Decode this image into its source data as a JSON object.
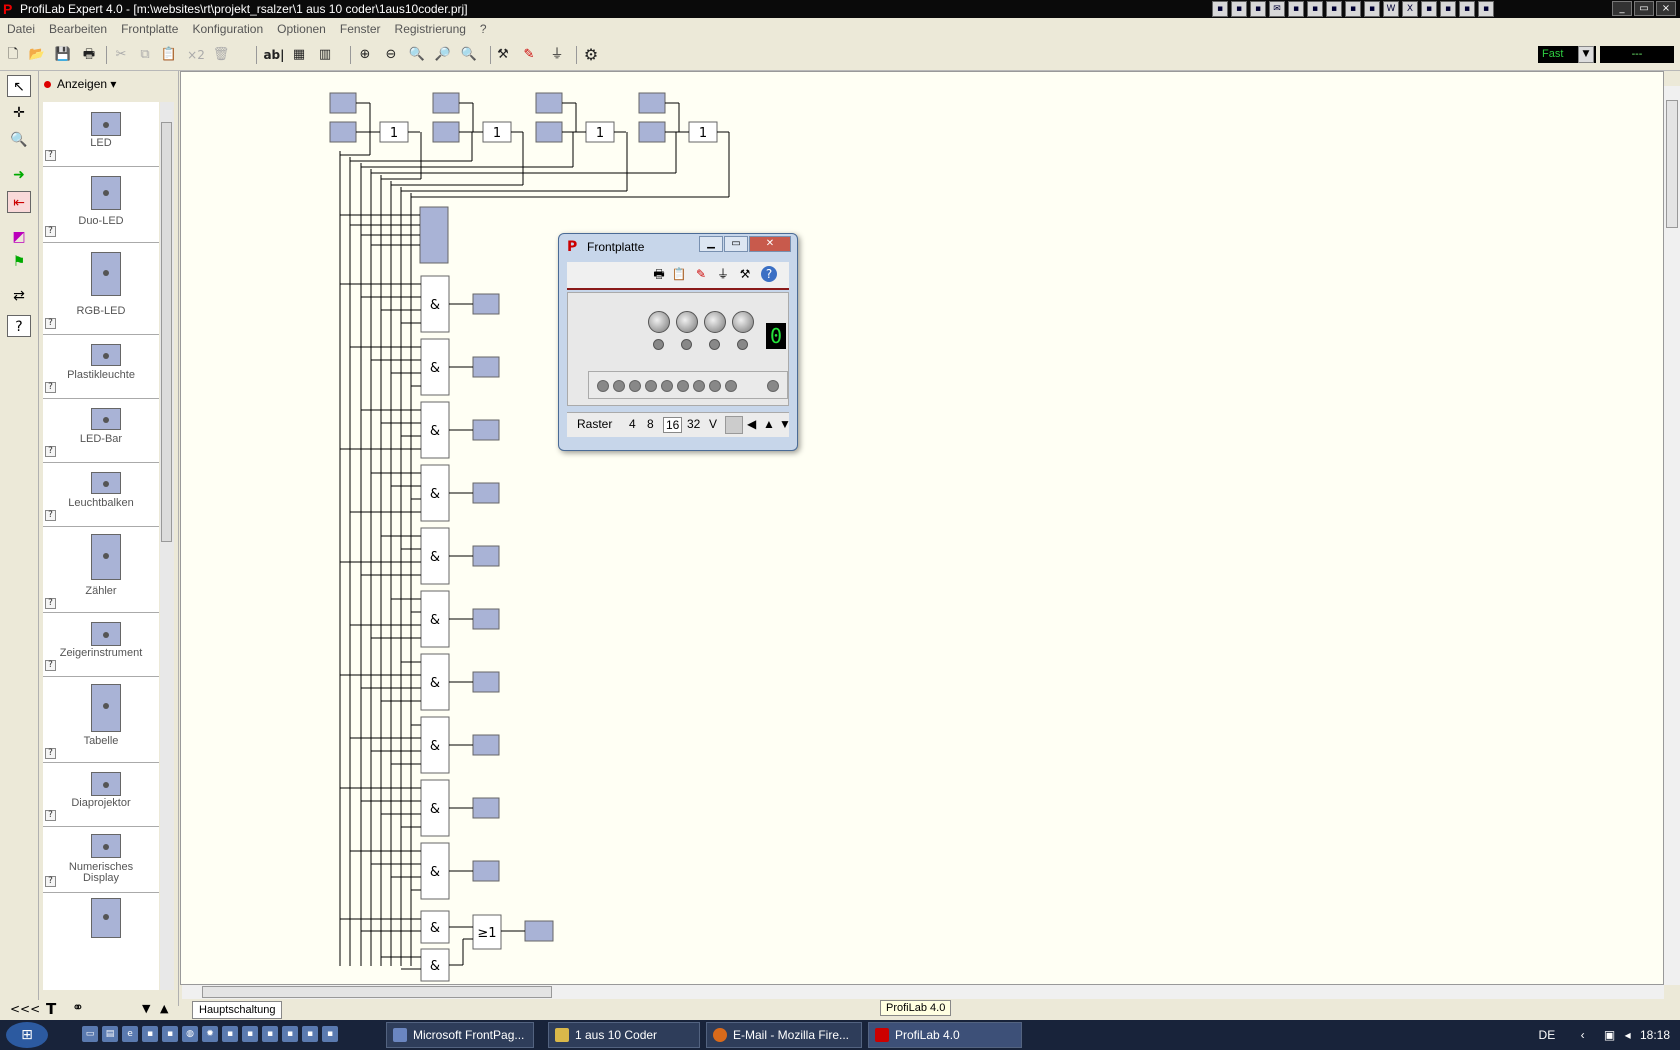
{
  "window": {
    "title": "ProfiLab Expert 4.0 - [m:\\websites\\rt\\projekt_rsalzer\\1 aus 10 coder\\1aus10coder.prj]",
    "app_letter": "P",
    "controls": [
      "_",
      "▭",
      "×"
    ]
  },
  "menu": [
    "Datei",
    "Bearbeiten",
    "Frontplatte",
    "Konfiguration",
    "Optionen",
    "Fenster",
    "Registrierung",
    "?"
  ],
  "toolbar": {
    "tools": [
      "new-file",
      "open-folder",
      "save",
      "print",
      "cut",
      "copy",
      "paste",
      "duplicate",
      "delete",
      "text-label",
      "grid",
      "columns",
      "zoom-in",
      "zoom-out",
      "zoom-fit",
      "zoom-window",
      "zoom-all",
      "tools",
      "wire",
      "plug",
      "settings"
    ],
    "text_ab": "ab|",
    "text_x2": "×2",
    "speed": "Fast",
    "speed_display": "---"
  },
  "left_tools": [
    "pointer",
    "crosshair",
    "zoom",
    "run",
    "stop",
    "color-palette",
    "flag",
    "transfer",
    "help-pointer"
  ],
  "panel": {
    "dropdown": "Anzeigen",
    "items": [
      "LED",
      "Duo-LED",
      "RGB-LED",
      "Plastikleuchte",
      "LED-Bar",
      "Leuchtbalken",
      "Zähler",
      "Zeigerinstrument",
      "Tabelle",
      "Diaprojektor",
      "Numerisches Display"
    ],
    "collapse": "<<<",
    "text_tool": "T",
    "binoculars": "⚭",
    "help_mark": "?"
  },
  "canvas": {
    "inverter_label": "1",
    "and_label": "&",
    "or_label": "≥1"
  },
  "frontplatte": {
    "title": "Frontplatte",
    "display_value": "0",
    "raster_label": "Raster",
    "raster_options": [
      "4",
      "8",
      "16",
      "32",
      "V"
    ]
  },
  "tab": "Hauptschaltung",
  "tooltip": "ProfiLab 4.0",
  "taskbar": {
    "tasks": [
      "Microsoft FrontPag...",
      "1 aus 10 Coder",
      "E-Mail - Mozilla Fire...",
      "ProfiLab 4.0"
    ],
    "lang": "DE",
    "clock": "18:18"
  },
  "colors": {
    "canvas_bg": "#fffff4",
    "component_fill": "#a9b3d6",
    "display_green": "#25e33a",
    "taskbar_bg": "#18233a"
  }
}
